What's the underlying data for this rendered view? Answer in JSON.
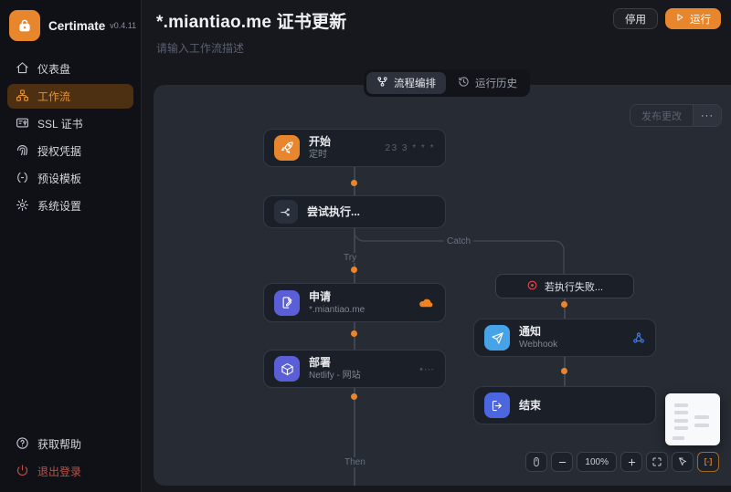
{
  "colors": {
    "accent": "#e8862e",
    "canvas_bg": "#262b34",
    "node_bg": "#1b1f27",
    "danger": "#e5484d"
  },
  "sidebar": {
    "brand": "Certimate",
    "version": "v0.4.11",
    "items": [
      {
        "label": "仪表盘",
        "icon": "dashboard-home-icon"
      },
      {
        "label": "工作流",
        "icon": "workflow-icon"
      },
      {
        "label": "SSL 证书",
        "icon": "certificate-icon"
      },
      {
        "label": "授权凭据",
        "icon": "credentials-icon"
      },
      {
        "label": "预设模板",
        "icon": "template-icon"
      },
      {
        "label": "系统设置",
        "icon": "settings-gear-icon"
      }
    ],
    "footer_items": [
      {
        "label": "获取帮助",
        "icon": "help-icon"
      },
      {
        "label": "退出登录",
        "icon": "logout-power-icon"
      }
    ]
  },
  "header": {
    "title": "*.miantiao.me 证书更新",
    "description_placeholder": "请输入工作流描述",
    "disable_button": "停用",
    "run_button": "运行"
  },
  "tabs": [
    {
      "label": "流程编排",
      "icon": "flow-design-icon",
      "active": true
    },
    {
      "label": "运行历史",
      "icon": "run-history-icon",
      "active": false
    }
  ],
  "canvas": {
    "publish_button": "发布更改",
    "more_button": "···",
    "labels": {
      "try": "Try",
      "catch": "Catch",
      "then": "Then"
    },
    "nodes": {
      "start": {
        "title": "开始",
        "subtitle": "定时",
        "meta": "23 3 * * *",
        "icon": "rocket-icon"
      },
      "try_block": {
        "title": "尝试执行...",
        "icon": "branch-split-icon"
      },
      "catch_block": {
        "title": "若执行失败...",
        "icon": "record-dot-icon"
      },
      "apply": {
        "title": "申请",
        "subtitle": "*.miantiao.me",
        "icon": "file-pen-icon",
        "right_icon": "cloudflare-icon"
      },
      "deploy": {
        "title": "部署",
        "subtitle": "Netlify - 网站",
        "icon": "package-icon",
        "right_icon": "more-dots-icon"
      },
      "notify": {
        "title": "通知",
        "subtitle": "Webhook",
        "icon": "paper-plane-icon",
        "right_icon": "webhook-icon"
      },
      "end": {
        "title": "结束",
        "icon": "exit-icon"
      }
    },
    "toolbar": {
      "zoom_level": "100%"
    }
  },
  "icons": {
    "brand": "lock-icon",
    "run": "play-icon",
    "toolbar": [
      "pan-mouse-icon",
      "zoom-out-icon",
      "zoom-level",
      "zoom-in-icon",
      "fit-view-icon",
      "cursor-select-icon",
      "minimap-toggle-icon"
    ]
  }
}
